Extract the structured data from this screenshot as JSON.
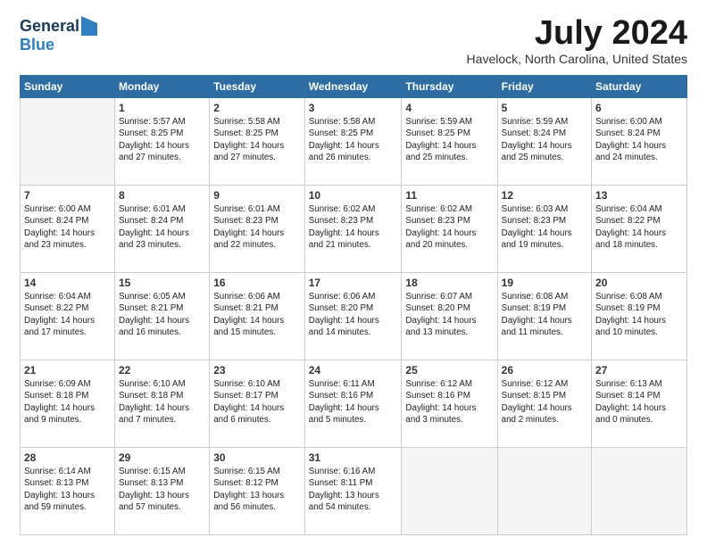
{
  "logo": {
    "general": "General",
    "blue": "Blue"
  },
  "title": "July 2024",
  "location": "Havelock, North Carolina, United States",
  "days_of_week": [
    "Sunday",
    "Monday",
    "Tuesday",
    "Wednesday",
    "Thursday",
    "Friday",
    "Saturday"
  ],
  "weeks": [
    [
      {
        "num": "",
        "info": ""
      },
      {
        "num": "1",
        "info": "Sunrise: 5:57 AM\nSunset: 8:25 PM\nDaylight: 14 hours\nand 27 minutes."
      },
      {
        "num": "2",
        "info": "Sunrise: 5:58 AM\nSunset: 8:25 PM\nDaylight: 14 hours\nand 27 minutes."
      },
      {
        "num": "3",
        "info": "Sunrise: 5:58 AM\nSunset: 8:25 PM\nDaylight: 14 hours\nand 26 minutes."
      },
      {
        "num": "4",
        "info": "Sunrise: 5:59 AM\nSunset: 8:25 PM\nDaylight: 14 hours\nand 25 minutes."
      },
      {
        "num": "5",
        "info": "Sunrise: 5:59 AM\nSunset: 8:24 PM\nDaylight: 14 hours\nand 25 minutes."
      },
      {
        "num": "6",
        "info": "Sunrise: 6:00 AM\nSunset: 8:24 PM\nDaylight: 14 hours\nand 24 minutes."
      }
    ],
    [
      {
        "num": "7",
        "info": "Sunrise: 6:00 AM\nSunset: 8:24 PM\nDaylight: 14 hours\nand 23 minutes."
      },
      {
        "num": "8",
        "info": "Sunrise: 6:01 AM\nSunset: 8:24 PM\nDaylight: 14 hours\nand 23 minutes."
      },
      {
        "num": "9",
        "info": "Sunrise: 6:01 AM\nSunset: 8:23 PM\nDaylight: 14 hours\nand 22 minutes."
      },
      {
        "num": "10",
        "info": "Sunrise: 6:02 AM\nSunset: 8:23 PM\nDaylight: 14 hours\nand 21 minutes."
      },
      {
        "num": "11",
        "info": "Sunrise: 6:02 AM\nSunset: 8:23 PM\nDaylight: 14 hours\nand 20 minutes."
      },
      {
        "num": "12",
        "info": "Sunrise: 6:03 AM\nSunset: 8:23 PM\nDaylight: 14 hours\nand 19 minutes."
      },
      {
        "num": "13",
        "info": "Sunrise: 6:04 AM\nSunset: 8:22 PM\nDaylight: 14 hours\nand 18 minutes."
      }
    ],
    [
      {
        "num": "14",
        "info": "Sunrise: 6:04 AM\nSunset: 8:22 PM\nDaylight: 14 hours\nand 17 minutes."
      },
      {
        "num": "15",
        "info": "Sunrise: 6:05 AM\nSunset: 8:21 PM\nDaylight: 14 hours\nand 16 minutes."
      },
      {
        "num": "16",
        "info": "Sunrise: 6:06 AM\nSunset: 8:21 PM\nDaylight: 14 hours\nand 15 minutes."
      },
      {
        "num": "17",
        "info": "Sunrise: 6:06 AM\nSunset: 8:20 PM\nDaylight: 14 hours\nand 14 minutes."
      },
      {
        "num": "18",
        "info": "Sunrise: 6:07 AM\nSunset: 8:20 PM\nDaylight: 14 hours\nand 13 minutes."
      },
      {
        "num": "19",
        "info": "Sunrise: 6:08 AM\nSunset: 8:19 PM\nDaylight: 14 hours\nand 11 minutes."
      },
      {
        "num": "20",
        "info": "Sunrise: 6:08 AM\nSunset: 8:19 PM\nDaylight: 14 hours\nand 10 minutes."
      }
    ],
    [
      {
        "num": "21",
        "info": "Sunrise: 6:09 AM\nSunset: 8:18 PM\nDaylight: 14 hours\nand 9 minutes."
      },
      {
        "num": "22",
        "info": "Sunrise: 6:10 AM\nSunset: 8:18 PM\nDaylight: 14 hours\nand 7 minutes."
      },
      {
        "num": "23",
        "info": "Sunrise: 6:10 AM\nSunset: 8:17 PM\nDaylight: 14 hours\nand 6 minutes."
      },
      {
        "num": "24",
        "info": "Sunrise: 6:11 AM\nSunset: 8:16 PM\nDaylight: 14 hours\nand 5 minutes."
      },
      {
        "num": "25",
        "info": "Sunrise: 6:12 AM\nSunset: 8:16 PM\nDaylight: 14 hours\nand 3 minutes."
      },
      {
        "num": "26",
        "info": "Sunrise: 6:12 AM\nSunset: 8:15 PM\nDaylight: 14 hours\nand 2 minutes."
      },
      {
        "num": "27",
        "info": "Sunrise: 6:13 AM\nSunset: 8:14 PM\nDaylight: 14 hours\nand 0 minutes."
      }
    ],
    [
      {
        "num": "28",
        "info": "Sunrise: 6:14 AM\nSunset: 8:13 PM\nDaylight: 13 hours\nand 59 minutes."
      },
      {
        "num": "29",
        "info": "Sunrise: 6:15 AM\nSunset: 8:13 PM\nDaylight: 13 hours\nand 57 minutes."
      },
      {
        "num": "30",
        "info": "Sunrise: 6:15 AM\nSunset: 8:12 PM\nDaylight: 13 hours\nand 56 minutes."
      },
      {
        "num": "31",
        "info": "Sunrise: 6:16 AM\nSunset: 8:11 PM\nDaylight: 13 hours\nand 54 minutes."
      },
      {
        "num": "",
        "info": ""
      },
      {
        "num": "",
        "info": ""
      },
      {
        "num": "",
        "info": ""
      }
    ]
  ]
}
